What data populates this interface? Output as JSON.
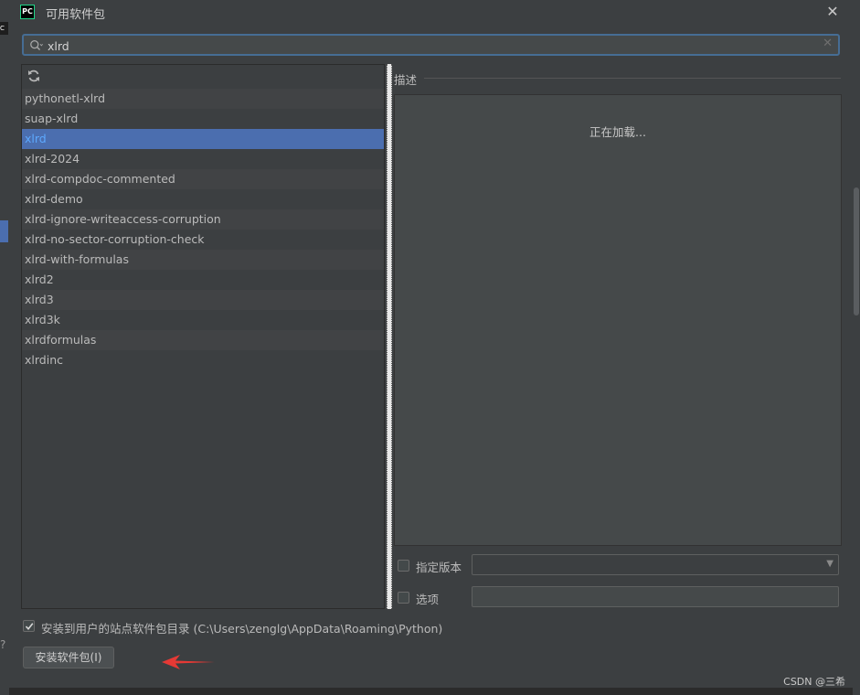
{
  "dialog": {
    "app_logo_text": "PC",
    "title": "可用软件包",
    "close_glyph": "✕"
  },
  "search": {
    "value": "xlrd",
    "clear_glyph": "✕"
  },
  "packages": [
    "pythonetl-xlrd",
    "suap-xlrd",
    "xlrd",
    "xlrd-2024",
    "xlrd-compdoc-commented",
    "xlrd-demo",
    "xlrd-ignore-writeaccess-corruption",
    "xlrd-no-sector-corruption-check",
    "xlrd-with-formulas",
    "xlrd2",
    "xlrd3",
    "xlrd3k",
    "xlrdformulas",
    "xlrdinc"
  ],
  "selected_index": 2,
  "description": {
    "label": "描述",
    "loading_text": "正在加载..."
  },
  "specify_version": {
    "label": "指定版本",
    "checked": false,
    "value": ""
  },
  "options": {
    "label": "选项",
    "checked": false,
    "value": ""
  },
  "install_to_user": {
    "label": "安装到用户的站点软件包目录 (C:\\Users\\zenglg\\AppData\\Roaming\\Python)",
    "checked": true
  },
  "install_button": {
    "label": "安装软件包(I)"
  },
  "watermark": "CSDN @三希",
  "colors": {
    "selection": "#4b6eaf",
    "selected_text": "#5da9ff",
    "annotation_arrow": "#e53935",
    "focus_border": "#466d94"
  }
}
